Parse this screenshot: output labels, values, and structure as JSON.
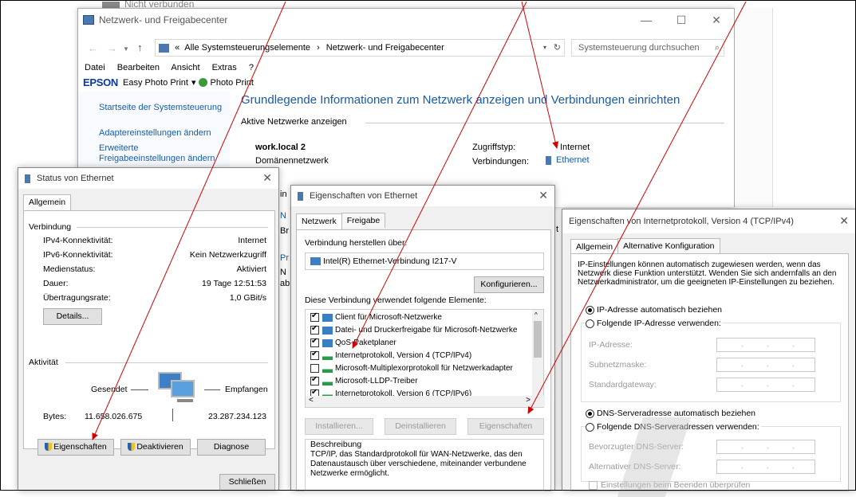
{
  "main": {
    "top_fragment": "Nicht verbunden",
    "title": "Netzwerk- und Freigabecenter",
    "breadcrumb_prefix": "«",
    "breadcrumb_1": "Alle Systemsteuerungselemente",
    "breadcrumb_sep": "›",
    "breadcrumb_2": "Netzwerk- und Freigabecenter",
    "search_placeholder": "Systemsteuerung durchsuchen",
    "menu": [
      "Datei",
      "Bearbeiten",
      "Ansicht",
      "Extras",
      "?"
    ],
    "epson": "EPSON",
    "epson_item1": "Easy Photo Print",
    "epson_dropdown": "▾",
    "epson_item2": "Photo Print",
    "sidebar": [
      "Startseite der Systemsteuerung",
      "Adaptereinstellungen ändern",
      "Erweiterte Freigabeeinstellungen ändern"
    ],
    "heading": "Grundlegende Informationen zum Netzwerk anzeigen und Verbindungen einrichten",
    "active_networks": "Aktive Netzwerke anzeigen",
    "network_name": "work.local  2",
    "network_type": "Domänennetzwerk",
    "access_label": "Zugriffstyp:",
    "access_value": "Internet",
    "conn_label": "Verbindungen:",
    "conn_value": "Ethernet",
    "behind_fragments": [
      "in",
      "N",
      "Br",
      "Pr",
      "N",
      "ab"
    ],
    "behind_t": "t"
  },
  "status": {
    "title": "Status von Ethernet",
    "tab": "Allgemein",
    "group_connection": "Verbindung",
    "rows": [
      {
        "label": "IPv4-Konnektivität:",
        "value": "Internet"
      },
      {
        "label": "IPv6-Konnektivität:",
        "value": "Kein Netzwerkzugriff"
      },
      {
        "label": "Medienstatus:",
        "value": "Aktiviert"
      },
      {
        "label": "Dauer:",
        "value": "19 Tage 12:51:53"
      },
      {
        "label": "Übertragungsrate:",
        "value": "1,0 GBit/s"
      }
    ],
    "details_btn": "Details...",
    "group_activity": "Aktivität",
    "sent": "Gesendet",
    "received": "Empfangen",
    "bytes_label": "Bytes:",
    "bytes_sent": "11.658.026.675",
    "bytes_received": "23.287.234.123",
    "btn_properties": "Eigenschaften",
    "btn_disable": "Deaktivieren",
    "btn_diagnose": "Diagnose",
    "btn_close": "Schließen"
  },
  "props": {
    "title": "Eigenschaften von Ethernet",
    "tabs": [
      "Netzwerk",
      "Freigabe"
    ],
    "connect_via": "Verbindung herstellen über:",
    "adapter": "Intel(R) Ethernet-Verbindung I217-V",
    "configure_btn": "Konfigurieren...",
    "uses_items": "Diese Verbindung verwendet folgende Elemente:",
    "items": [
      {
        "label": "Client für Microsoft-Netzwerke",
        "checked": true
      },
      {
        "label": "Datei- und Druckerfreigabe für Microsoft-Netzwerke",
        "checked": true
      },
      {
        "label": "QoS-Paketplaner",
        "checked": true
      },
      {
        "label": "Internetprotokoll, Version 4 (TCP/IPv4)",
        "checked": true
      },
      {
        "label": "Microsoft-Multiplexorprotokoll für Netzwerkadapter",
        "checked": false
      },
      {
        "label": "Microsoft-LLDP-Treiber",
        "checked": true
      },
      {
        "label": "Internetprotokoll, Version 6 (TCP/IPv6)",
        "checked": true
      }
    ],
    "btn_install": "Installieren...",
    "btn_uninstall": "Deinstallieren",
    "btn_properties": "Eigenschaften",
    "desc_title": "Beschreibung",
    "desc_text": "TCP/IP, das Standardprotokoll für WAN-Netzwerke, das den Datenaustausch über verschiedene, miteinander verbundene Netzwerke ermöglicht."
  },
  "ipv4": {
    "title": "Eigenschaften von Internetprotokoll, Version 4 (TCP/IPv4)",
    "tabs": [
      "Allgemein",
      "Alternative Konfiguration"
    ],
    "intro": "IP-Einstellungen können automatisch zugewiesen werden, wenn das Netzwerk diese Funktion unterstützt. Wenden Sie sich andernfalls an den Netzwerkadministrator, um die geeigneten IP-Einstellungen zu beziehen.",
    "auto_ip": "IP-Adresse automatisch beziehen",
    "manual_ip": "Folgende IP-Adresse verwenden:",
    "ip_label": "IP-Adresse:",
    "mask_label": "Subnetzmaske:",
    "gw_label": "Standardgateway:",
    "auto_dns": "DNS-Serveradresse automatisch beziehen",
    "manual_dns": "Folgende DNS-Serveradressen verwenden:",
    "pref_dns": "Bevorzugter DNS-Server:",
    "alt_dns": "Alternativer DNS-Server:",
    "validate": "Einstellungen beim Beenden überprüfen",
    "dot": "."
  },
  "colors": {
    "accent_link": "#1a5aa6",
    "arrow": "#d40000"
  }
}
